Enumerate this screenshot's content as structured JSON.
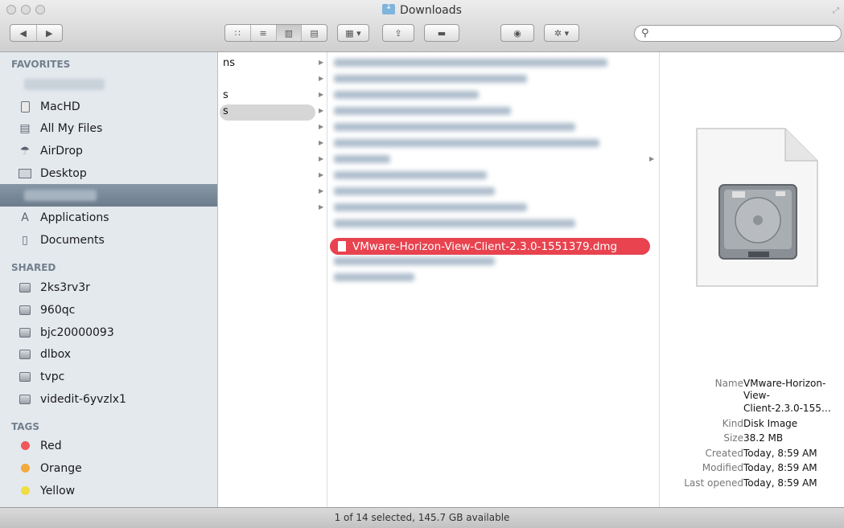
{
  "window": {
    "title": "Downloads"
  },
  "toolbar": {
    "back_forward": [
      "◀",
      "▶"
    ],
    "view_icons": [
      "icon-view",
      "list-view",
      "column-view",
      "coverflow-view"
    ],
    "arrange_label": "▦ ▾",
    "share_label": "⇪",
    "tag_label": "▬",
    "quicklook_label": "◉",
    "action_label": "✲ ▾",
    "search_placeholder": ""
  },
  "sidebar": {
    "favorites_header": "FAVORITES",
    "favorites": [
      {
        "label": "MacHD",
        "icon": "harddisk-icon"
      },
      {
        "label": "All My Files",
        "icon": "all-files-icon"
      },
      {
        "label": "AirDrop",
        "icon": "airdrop-icon"
      },
      {
        "label": "Desktop",
        "icon": "desktop-icon"
      },
      {
        "label": "Applications",
        "icon": "applications-icon"
      },
      {
        "label": "Documents",
        "icon": "documents-icon"
      }
    ],
    "shared_header": "SHARED",
    "shared": [
      "2ks3rv3r",
      "960qc",
      "bjc20000093",
      "dlbox",
      "tvpc",
      "videdit-6yvzlx1"
    ],
    "tags_header": "TAGS",
    "tags": [
      {
        "label": "Red",
        "color": "#f0595a"
      },
      {
        "label": "Orange",
        "color": "#f3a93b"
      },
      {
        "label": "Yellow",
        "color": "#f1dc44"
      }
    ]
  },
  "column1": {
    "fragments": [
      "ns",
      "s",
      "s"
    ]
  },
  "column2": {
    "selected_file": "VMware-Horizon-View-Client-2.3.0-1551379.dmg"
  },
  "preview": {
    "labels": {
      "name": "Name",
      "kind": "Kind",
      "size": "Size",
      "created": "Created",
      "modified": "Modified",
      "last_opened": "Last opened"
    },
    "name_lines": [
      "VMware-Horizon-",
      "View-",
      "Client-2.3.0-155…"
    ],
    "kind": "Disk Image",
    "size": "38.2 MB",
    "created": "Today, 8:59 AM",
    "modified": "Today, 8:59 AM",
    "last_opened": "Today, 8:59 AM"
  },
  "status": {
    "text": "1 of 14 selected, 145.7 GB available"
  },
  "colors": {
    "selection": "#e8434f",
    "sidebar_bg": "#e4e9ee"
  }
}
